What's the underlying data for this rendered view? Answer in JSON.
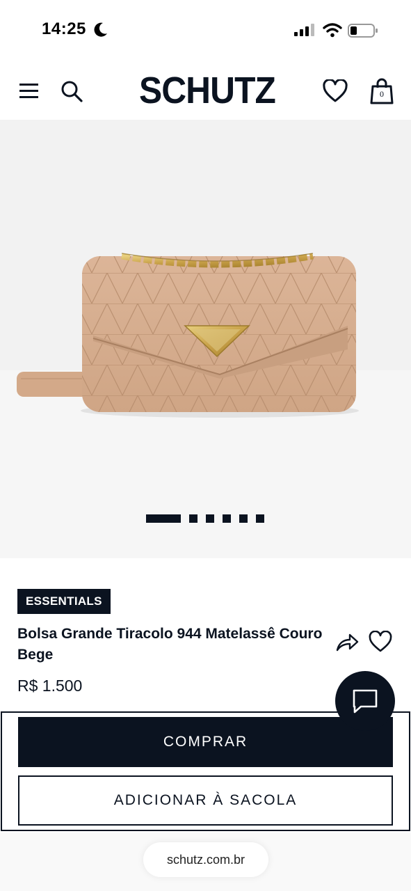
{
  "status_bar": {
    "time": "14:25",
    "icons": [
      "moon-icon",
      "signal-icon",
      "wifi-icon",
      "battery-icon"
    ]
  },
  "header": {
    "logo": "SCHUTZ",
    "cart_count": "0",
    "icons": [
      "menu-icon",
      "search-icon",
      "heart-icon",
      "shopping-bag-icon"
    ]
  },
  "gallery": {
    "image": "beige quilted leather crossbody bag with gold chain",
    "slide_count": 6,
    "active_slide": 1
  },
  "product": {
    "badge": "ESSENTIALS",
    "title": "Bolsa Grande Tiracolo 944 Matelassê Couro Bege",
    "price": "R$ 1.500"
  },
  "actions": {
    "buy_label": "COMPRAR",
    "add_to_bag_label": "ADICIONAR À SACOLA"
  },
  "browser": {
    "url": "schutz.com.br"
  },
  "colors": {
    "brand_dark": "#0b1320",
    "bag_beige": "#d6af90",
    "gold": "#c9a24a"
  }
}
